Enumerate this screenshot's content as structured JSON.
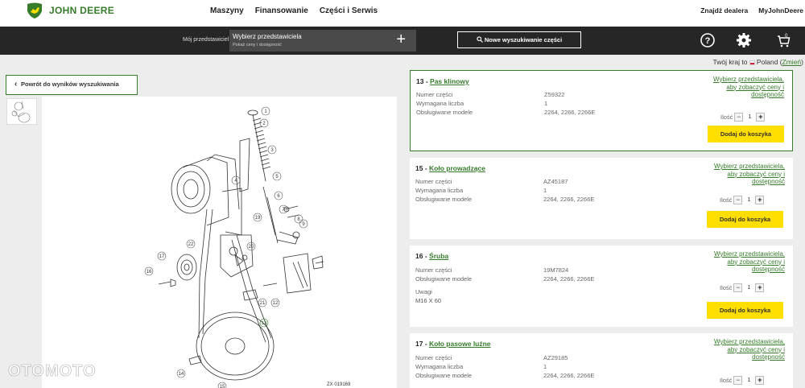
{
  "brand": {
    "name": "JOHN DEERE"
  },
  "nav": {
    "items": [
      "Maszyny",
      "Finansowanie",
      "Części i Serwis"
    ]
  },
  "right_nav": {
    "find_dealer": "Znajdź dealera",
    "my_jd": "MyJohnDeere"
  },
  "dealer_bar": {
    "label": "Mój przedstawiciel",
    "box_title": "Wybierz przedstawiciela",
    "box_subtitle": "Pokaż ceny i dostępność",
    "new_search": "Nowe wyszukiwanie części"
  },
  "country": {
    "prefix": "Twój kraj to",
    "name": "Poland",
    "change": "Zmień"
  },
  "back_button": "Powrót do wyników wyszukiwania",
  "diagram": {
    "code": "ZX 019169",
    "callouts": [
      "1",
      "2",
      "3",
      "4",
      "5",
      "6",
      "7",
      "8",
      "9",
      "19",
      "20",
      "22",
      "17",
      "16",
      "21",
      "12",
      "13",
      "14",
      "15"
    ]
  },
  "labels": {
    "part_number": "Numer części",
    "required_qty": "Wymagana liczba",
    "models": "Obsługiwane modele",
    "notes": "Uwagi",
    "qty": "Ilość",
    "price_link": "Wybierz przedstawiciela, aby zobaczyć ceny i dostępność",
    "add_to_cart": "Dodaj do koszyka"
  },
  "parts": [
    {
      "num": "13",
      "name": "Pas klinowy",
      "part_number": "Z59322",
      "required": "1",
      "models": "2264, 2266, 2266E",
      "qty": "1"
    },
    {
      "num": "15",
      "name": "Koło prowadzące",
      "part_number": "AZ45187",
      "required": "1",
      "models": "2264, 2266, 2266E",
      "qty": "1"
    },
    {
      "num": "16",
      "name": "Śruba",
      "part_number": "19M7824",
      "models": "2264, 2266, 2266E",
      "notes": "M16 X 60",
      "qty": "1"
    },
    {
      "num": "17",
      "name": "Koło pasowe luźne",
      "part_number": "AZ29185",
      "required": "1",
      "models": "2264, 2266, 2266E",
      "qty": "1"
    }
  ],
  "watermark": "OTOMOTO",
  "colors": {
    "brand_green": "#367c2b",
    "brand_yellow": "#ffde00",
    "dark_bar": "#262626"
  }
}
